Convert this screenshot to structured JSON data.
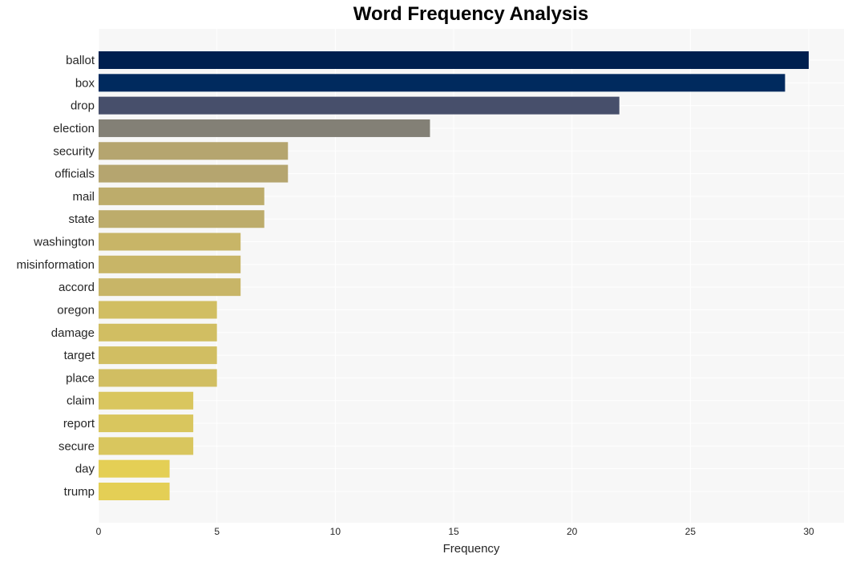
{
  "chart_data": {
    "type": "bar",
    "orientation": "horizontal",
    "title": "Word Frequency Analysis",
    "xlabel": "Frequency",
    "ylabel": "",
    "xlim": [
      0,
      31.5
    ],
    "xticks": [
      0,
      5,
      10,
      15,
      20,
      25,
      30
    ],
    "grid": true,
    "categories": [
      "ballot",
      "box",
      "drop",
      "election",
      "security",
      "officials",
      "mail",
      "state",
      "washington",
      "misinformation",
      "accord",
      "oregon",
      "damage",
      "target",
      "place",
      "claim",
      "report",
      "secure",
      "day",
      "trump"
    ],
    "values": [
      30,
      29,
      22,
      14,
      8,
      8,
      7,
      7,
      6,
      6,
      6,
      5,
      5,
      5,
      5,
      4,
      4,
      4,
      3,
      3
    ],
    "colors": [
      "#00204f",
      "#002a5e",
      "#474f6b",
      "#838076",
      "#b5a56f",
      "#b5a56f",
      "#bdac6b",
      "#bdac6b",
      "#c8b567",
      "#c8b567",
      "#c8b567",
      "#d1be62",
      "#d1be62",
      "#d1be62",
      "#d1be62",
      "#d9c65e",
      "#d9c65e",
      "#d9c65e",
      "#e4cf55",
      "#e4cf55"
    ],
    "plot_background": "#f7f7f7"
  }
}
